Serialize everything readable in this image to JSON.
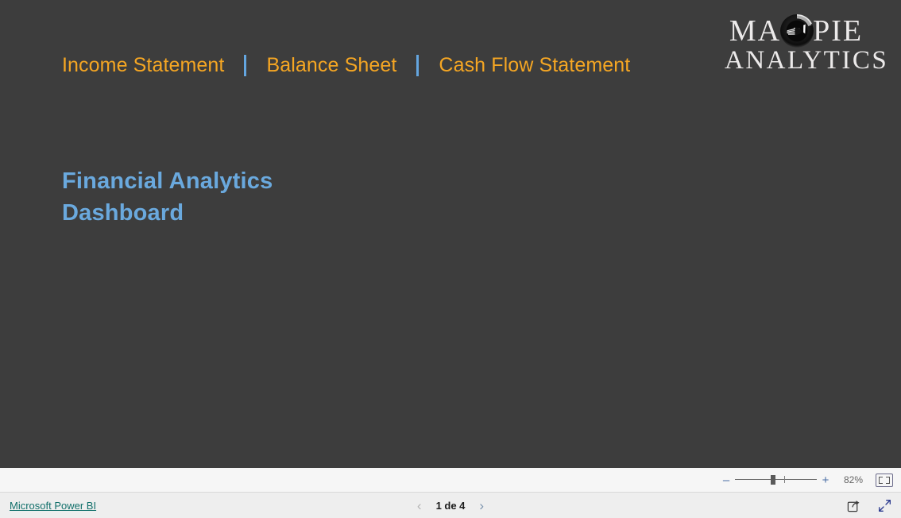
{
  "report": {
    "title_line1": "Financial Analytics",
    "title_line2": "Dashboard",
    "title_color": "#6aa9de",
    "background_color": "#3d3d3d",
    "nav_color": "#f5a623",
    "separator_color": "#64a6e0",
    "nav": [
      {
        "label": "Income Statement"
      },
      {
        "label": "Balance Sheet"
      },
      {
        "label": "Cash Flow Statement"
      }
    ],
    "separator": "|",
    "logo": {
      "line1_left": "MA",
      "line1_right": "PIE",
      "line2": "ANALYTICS",
      "mark": "magpie-circle-emblem"
    }
  },
  "zoombar": {
    "minus": "–",
    "plus": "+",
    "zoom_level": "82%",
    "fit_icon": "fit-to-page-icon"
  },
  "statusbar": {
    "brand": "Microsoft Power BI",
    "pager": {
      "prev_icon": "‹",
      "label": "1 de 4",
      "next_icon": "›"
    },
    "share_icon": "share-icon",
    "fullscreen_icon": "fullscreen-icon"
  }
}
